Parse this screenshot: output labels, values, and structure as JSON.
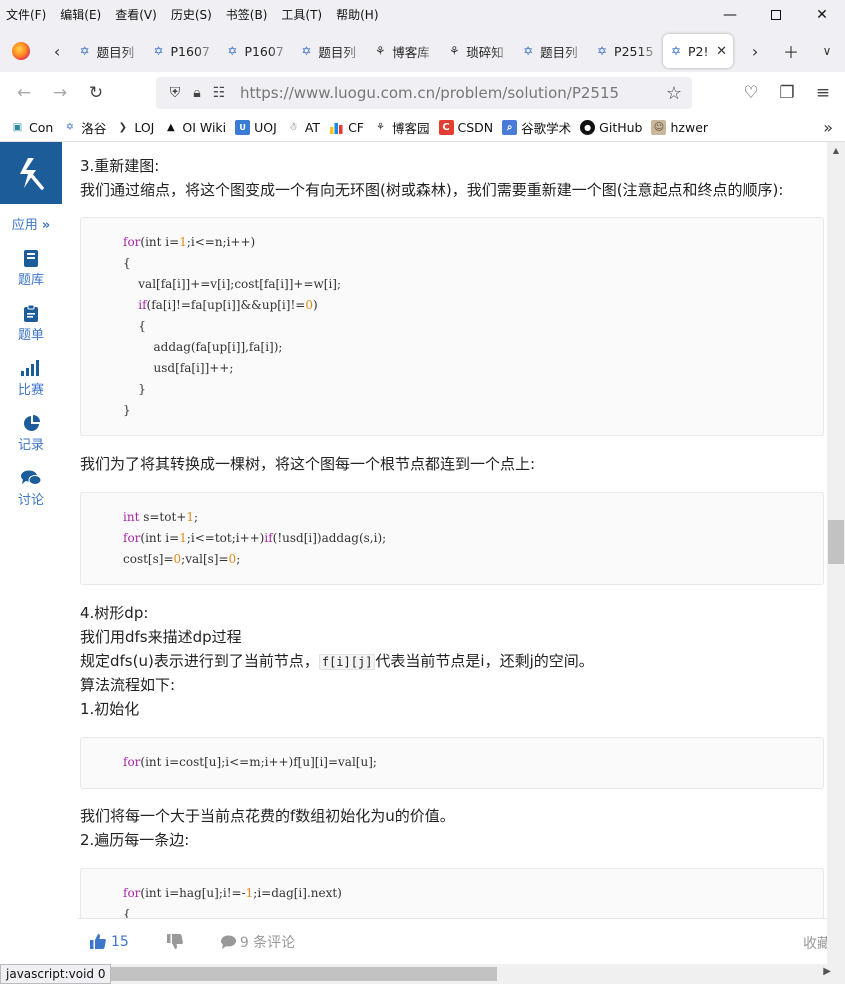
{
  "menubar": {
    "items": [
      "文件(F)",
      "编辑(E)",
      "查看(V)",
      "历史(S)",
      "书签(B)",
      "工具(T)",
      "帮助(H)"
    ]
  },
  "tabs": [
    {
      "label": "题目列",
      "icon": "luogu-icon"
    },
    {
      "label": "P1607",
      "icon": "luogu-icon"
    },
    {
      "label": "P1607",
      "icon": "luogu-icon"
    },
    {
      "label": "题目列",
      "icon": "luogu-icon"
    },
    {
      "label": "博客库",
      "icon": "cnblogs-icon"
    },
    {
      "label": "琐碎知",
      "icon": "cnblogs-icon"
    },
    {
      "label": "题目列",
      "icon": "luogu-icon"
    },
    {
      "label": "P2515",
      "icon": "luogu-icon"
    },
    {
      "label": "P2!",
      "icon": "luogu-icon",
      "active": true
    }
  ],
  "navbar": {
    "url_prefix": "https://www.",
    "url_host": "luogu.com.cn",
    "url_path": "/problem/solution/P2515"
  },
  "bookmarks": [
    {
      "label": "Con",
      "icon": "cube-icon"
    },
    {
      "label": "洛谷",
      "icon": "luogu-icon"
    },
    {
      "label": "LOJ",
      "icon": "loj-icon"
    },
    {
      "label": "OI Wiki",
      "icon": "graduation-cap-icon"
    },
    {
      "label": "UOJ",
      "icon": "uoj-icon"
    },
    {
      "label": "AT",
      "icon": "atcoder-icon"
    },
    {
      "label": "CF",
      "icon": "codeforces-icon"
    },
    {
      "label": "博客园",
      "icon": "cnblogs-icon"
    },
    {
      "label": "CSDN",
      "icon": "csdn-icon"
    },
    {
      "label": "谷歌学术",
      "icon": "scholar-icon"
    },
    {
      "label": "GitHub",
      "icon": "github-icon"
    },
    {
      "label": "hzwer",
      "icon": "avatar-icon"
    }
  ],
  "sidebar": {
    "apps_label": "应用",
    "items": [
      {
        "label": "题库",
        "icon": "book-icon"
      },
      {
        "label": "题单",
        "icon": "clipboard-icon"
      },
      {
        "label": "比赛",
        "icon": "bar-chart-icon"
      },
      {
        "label": "记录",
        "icon": "pie-chart-icon"
      },
      {
        "label": "讨论",
        "icon": "chat-icon"
      }
    ]
  },
  "content": {
    "p1": "3.重新建图:",
    "p2": "我们通过缩点，将这个图变成一个有向无环图(树或森林)，我们需要重新建一个图(注意起点和终点的顺序):",
    "p3": "我们为了将其转换成一棵树，将这个图每一个根节点都连到一个点上:",
    "p4": "4.树形dp:",
    "p5": "我们用dfs来描述dp过程",
    "p6_before": "规定dfs(u)表示进行到了当前节点，",
    "p6_code": "f[i][j]",
    "p6_after": "代表当前节点是i，还剩j的空间。",
    "p7": "算法流程如下:",
    "p8": "1.初始化",
    "p9": "我们将每一个大于当前点花费的f数组初始化为u的价值。",
    "p10": "2.遍历每一条边:"
  },
  "actions": {
    "likes": "15",
    "comments": "9 条评论",
    "favorite": "收藏"
  },
  "status": "javascript:void 0",
  "colors": {
    "luogu_blue": "#3e76c9",
    "logo_bg": "#1b5c99",
    "keyword": "#a626a4",
    "number": "#e08a14"
  }
}
